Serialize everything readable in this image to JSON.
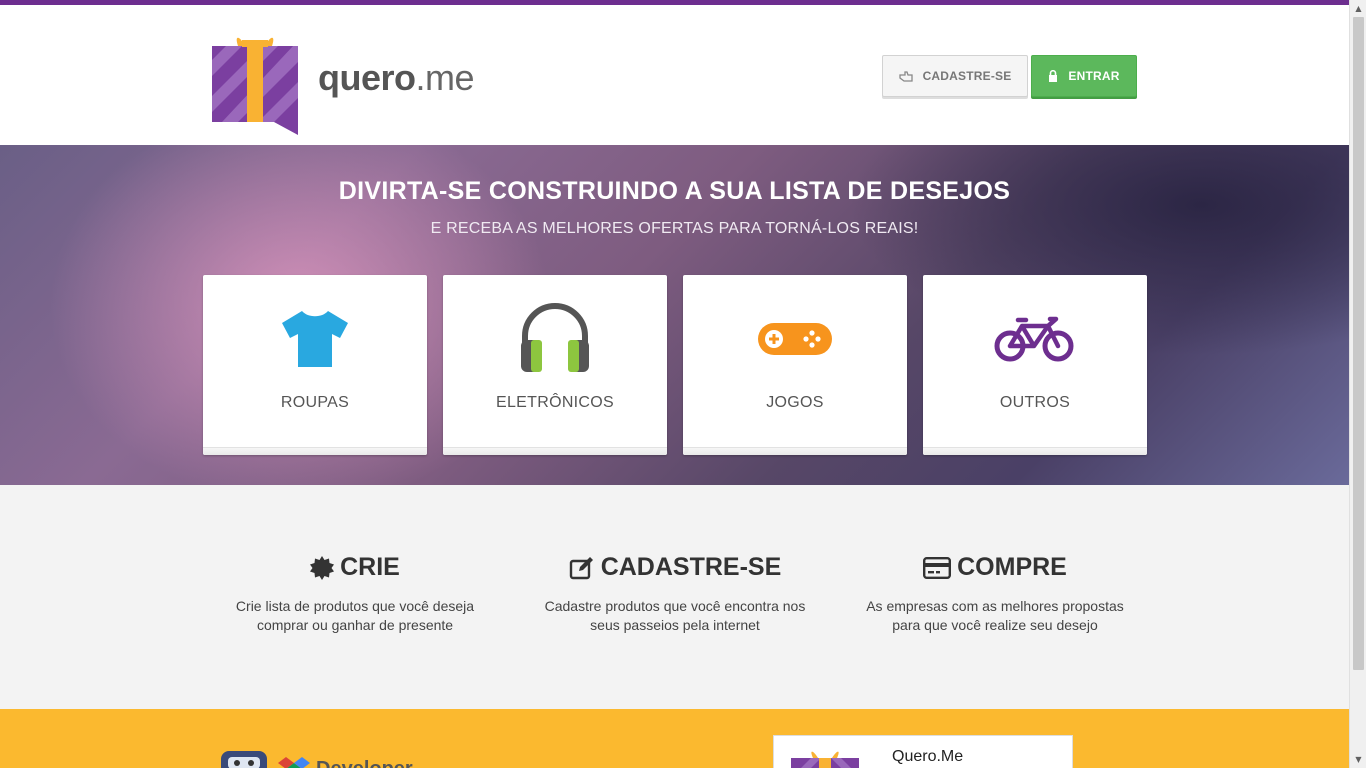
{
  "brand": {
    "bold": "quero",
    "light": ".me"
  },
  "header": {
    "signup_label": "CADASTRE-SE",
    "login_label": "ENTRAR"
  },
  "hero": {
    "title": "DIVIRTA-SE CONSTRUINDO A SUA LISTA DE DESEJOS",
    "subtitle": "E RECEBA AS MELHORES OFERTAS PARA TORNÁ-LOS REAIS!"
  },
  "categories": [
    {
      "label": "ROUPAS",
      "icon": "tshirt-icon",
      "color": "#29a8e0"
    },
    {
      "label": "ELETRÔNICOS",
      "icon": "headphones-icon",
      "color": "#8dc63f"
    },
    {
      "label": "JOGOS",
      "icon": "gamepad-icon",
      "color": "#f7941d"
    },
    {
      "label": "OUTROS",
      "icon": "bicycle-icon",
      "color": "#6d2e8f"
    }
  ],
  "features": [
    {
      "title": "CRIE",
      "icon": "badge-icon",
      "desc1": "Crie lista de produtos que você deseja",
      "desc2": "comprar ou ganhar de presente"
    },
    {
      "title": "CADASTRE-SE",
      "icon": "edit-icon",
      "desc1": "Cadastre produtos que você encontra nos",
      "desc2": "seus passeios pela internet"
    },
    {
      "title": "COMPRE",
      "icon": "credit-card-icon",
      "desc1": "As empresas com as melhores propostas",
      "desc2": "para que você realize seu desejo"
    }
  ],
  "footer": {
    "fb_name": "Quero.Me",
    "dev_text": "Developer"
  },
  "colors": {
    "purple": "#6d2e8f",
    "gold": "#fbb92f",
    "green": "#5cb85c"
  }
}
